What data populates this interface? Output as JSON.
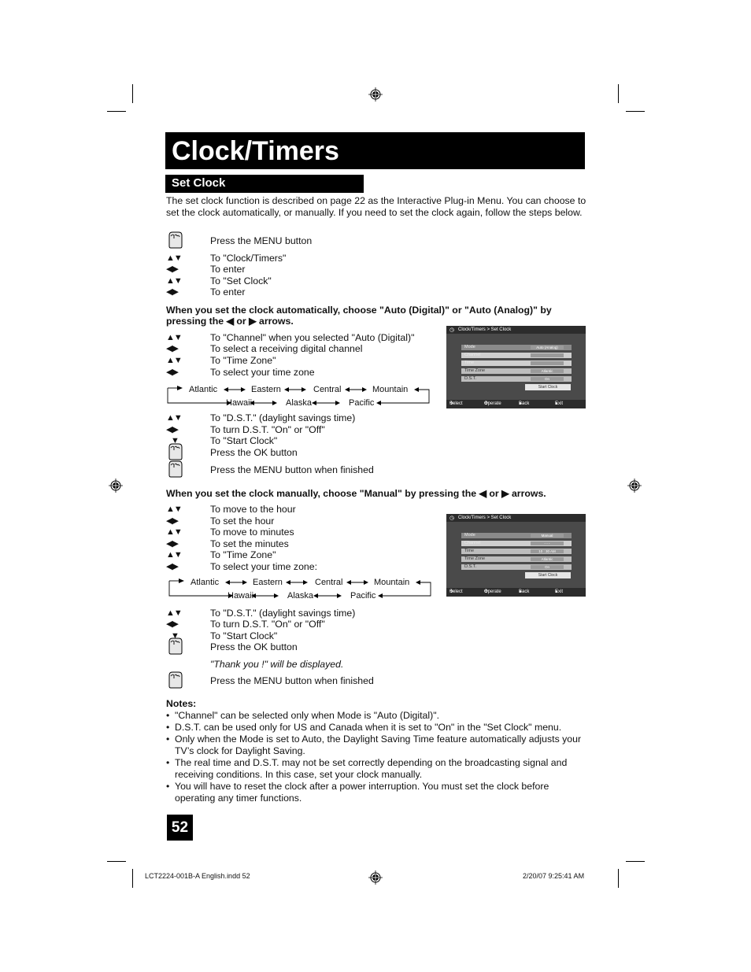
{
  "page": {
    "title": "Clock/Timers",
    "section": "Set Clock",
    "intro": "The set clock function is described on page 22 as the Interactive Plug-in Menu.  You can choose to set the clock automatically, or manually. If you need to set the clock again, follow the steps below.",
    "page_number": "52"
  },
  "steps_intro": [
    {
      "icon": "hand",
      "text": "Press the MENU button"
    },
    {
      "icon": "▲▼",
      "text": "To \"Clock/Timers\""
    },
    {
      "icon": "◀▶",
      "text": "To enter"
    },
    {
      "icon": "▲▼",
      "text": "To \"Set Clock\""
    },
    {
      "icon": "◀▶",
      "text": "To enter"
    }
  ],
  "auto": {
    "heading_1": "When you set the clock automatically, choose \"Auto (Digital)\" or \"Auto (Analog)\" by",
    "heading_2": "pressing the ◀ or ▶ arrows.",
    "steps": [
      {
        "icon": "▲▼",
        "text": "To \"Channel\" when you selected \"Auto (Digital)\""
      },
      {
        "icon": "◀▶",
        "text": "To select a receiving digital channel"
      },
      {
        "icon": "▲▼",
        "text": "To \"Time Zone\""
      },
      {
        "icon": "◀▶",
        "text": "To select your time zone"
      }
    ],
    "steps2": [
      {
        "icon": "▲▼",
        "text": "To \"D.S.T.\" (daylight savings time)"
      },
      {
        "icon": "◀▶",
        "text": "To turn D.S.T. \"On\" or \"Off\""
      },
      {
        "icon": "▼",
        "text": "To \"Start Clock\""
      },
      {
        "icon": "hand",
        "text": "Press the OK button"
      },
      {
        "icon": "hand",
        "text": "Press the MENU button when finished"
      }
    ],
    "screen": {
      "breadcrumb": "Clock/Timers > Set Clock",
      "rows": [
        {
          "label": "Mode",
          "value": "Auto (Analog)"
        },
        {
          "label": "Channel",
          "value": ""
        },
        {
          "label": "Time",
          "value": ""
        },
        {
          "label": "Time Zone",
          "value": "Atlantic"
        },
        {
          "label": "D.S.T.",
          "value": "On"
        }
      ],
      "start": "Start Clock",
      "footer": [
        "Select",
        "Operate",
        "Back",
        "Exit"
      ]
    }
  },
  "timezones": {
    "top": [
      "Atlantic",
      "Eastern",
      "Central",
      "Mountain"
    ],
    "bottom": [
      "Hawaii",
      "Alaska",
      "Pacific"
    ]
  },
  "manual": {
    "heading": "When you set the clock manually, choose \"Manual\" by pressing the ◀ or ▶ arrows.",
    "steps": [
      {
        "icon": "▲▼",
        "text": "To move to the hour"
      },
      {
        "icon": "◀▶",
        "text": "To set the hour"
      },
      {
        "icon": "▲▼",
        "text": "To move to minutes"
      },
      {
        "icon": "◀▶",
        "text": "To set the minutes"
      },
      {
        "icon": "▲▼",
        "text": "To \"Time Zone\""
      },
      {
        "icon": "◀▶",
        "text": "To select your time zone:"
      }
    ],
    "steps2": [
      {
        "icon": "▲▼",
        "text": "To \"D.S.T.\" (daylight savings time)"
      },
      {
        "icon": "◀▶",
        "text": "To turn D.S.T. \"On\" or \"Off\""
      },
      {
        "icon": "▼",
        "text": "To \"Start Clock\""
      },
      {
        "icon": "hand",
        "text": "Press the OK button"
      }
    ],
    "thank_you": "\"Thank you !\" will be displayed.",
    "final": "Press the MENU button when finished",
    "screen": {
      "breadcrumb": "Clock/Timers > Set Clock",
      "rows": [
        {
          "label": "Mode",
          "value": "Manual"
        },
        {
          "label": "Channel",
          "value": "- - -"
        },
        {
          "label": "Time",
          "value": "10 : 30  AM"
        },
        {
          "label": "Time Zone",
          "value": "Atlantic"
        },
        {
          "label": "D.S.T.",
          "value": "On"
        }
      ],
      "start": "Start Clock",
      "footer": [
        "Select",
        "Operate",
        "Back",
        "Exit"
      ]
    }
  },
  "notes": {
    "title": "Notes:",
    "items": [
      "\"Channel\" can be selected only when Mode is \"Auto (Digital)\".",
      "D.S.T. can be used only for US and Canada when it is set to \"On\" in the \"Set Clock\" menu.",
      "Only when the Mode is set to Auto, the Daylight Saving Time feature automatically adjusts your TV’s clock for Daylight Saving.",
      "The real time and D.S.T. may not be set correctly depending on the broadcasting signal and receiving conditions.  In this case, set your clock manually.",
      "You will have to reset the clock after a power interruption. You must set the clock before operating any timer functions."
    ]
  },
  "slug": {
    "file": "LCT2224-001B-A English.indd   52",
    "date": "2/20/07   9:25:41 AM"
  }
}
